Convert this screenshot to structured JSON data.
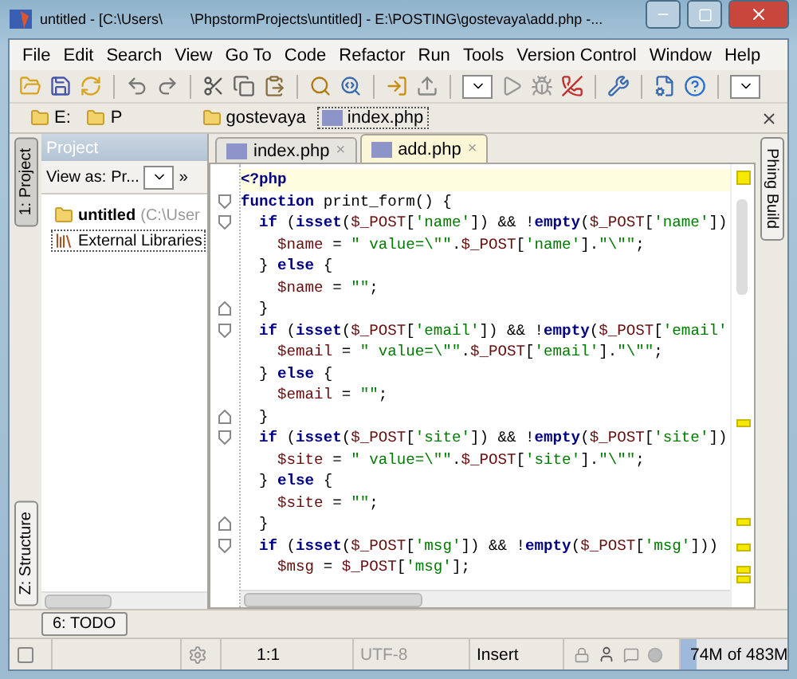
{
  "window": {
    "title": "untitled - [C:\\Users\\       \\PhpstormProjects\\untitled] - E:\\POSTING\\gostevaya\\add.php -..."
  },
  "menu": [
    "File",
    "Edit",
    "Search",
    "View",
    "Go To",
    "Code",
    "Refactor",
    "Run",
    "Tools",
    "Version Control",
    "Window",
    "Help"
  ],
  "breadcrumbs": [
    {
      "label": "E:",
      "kind": "folder"
    },
    {
      "label": "P",
      "kind": "folder"
    },
    {
      "label": "gostevaya",
      "kind": "folder"
    },
    {
      "label": "index.php",
      "kind": "file"
    }
  ],
  "left_tool_tabs": [
    {
      "label": "1: Project",
      "selected": true
    },
    {
      "label": "Z: Structure",
      "selected": false
    }
  ],
  "right_tool_tabs": [
    {
      "label": "Phing Build",
      "selected": false
    }
  ],
  "project_panel": {
    "title": "Project",
    "view_as_label": "View as:",
    "view_as_value": "Pr...",
    "more": "»",
    "tree": [
      {
        "label": "untitled",
        "hint": "(C:\\User",
        "kind": "folder",
        "selected": false
      },
      {
        "label": "External Libraries",
        "kind": "library",
        "selected": true
      }
    ]
  },
  "editor_tabs": [
    {
      "label": "index.php",
      "selected": false,
      "close": "×"
    },
    {
      "label": "add.php",
      "selected": true,
      "close": "×"
    }
  ],
  "code_lines": [
    {
      "kind": "plain",
      "tokens": [
        {
          "text": "**<?php**",
          "color": "#000080"
        }
      ]
    },
    {
      "kind": "fold-start",
      "tokens": [
        {
          "text": "**function**",
          "color": "#000080"
        },
        {
          "text": " print_form() {",
          "color": "#000000"
        }
      ]
    },
    {
      "kind": "fold-start",
      "tokens": [
        {
          "text": "  **if**",
          "color": "#000080"
        },
        {
          "text": " (",
          "color": "#000000"
        },
        {
          "text": "**isset**",
          "color": "#000080"
        },
        {
          "text": "(",
          "color": "#000000"
        },
        {
          "text": "$_POST",
          "color": "#660e0e"
        },
        {
          "text": "[",
          "color": "#000000"
        },
        {
          "text": "'name'",
          "color": "#007a00"
        },
        {
          "text": "]) && !",
          "color": "#000000"
        },
        {
          "text": "**empty**",
          "color": "#000080"
        },
        {
          "text": "(",
          "color": "#000000"
        },
        {
          "text": "$_POST",
          "color": "#660e0e"
        },
        {
          "text": "[",
          "color": "#000000"
        },
        {
          "text": "'name'",
          "color": "#007a00"
        },
        {
          "text": "])",
          "color": "#000000"
        }
      ]
    },
    {
      "kind": "plain",
      "tokens": [
        {
          "text": "    $name",
          "color": "#660e0e"
        },
        {
          "text": " = ",
          "color": "#000000"
        },
        {
          "text": "\" value=\\\"\"",
          "color": "#007a00"
        },
        {
          "text": "."
        },
        {
          "text": "$_POST",
          "color": "#660e0e"
        },
        {
          "text": "[",
          "color": "#000000"
        },
        {
          "text": "'name'",
          "color": "#007a00"
        },
        {
          "text": "].",
          "color": "#000000"
        },
        {
          "text": "\"\\\"\"",
          "color": "#007a00"
        },
        {
          "text": ";",
          "color": "#000000"
        }
      ]
    },
    {
      "kind": "plain",
      "tokens": [
        {
          "text": "  } ",
          "color": "#000000"
        },
        {
          "text": "**else**",
          "color": "#000080"
        },
        {
          "text": " {",
          "color": "#000000"
        }
      ]
    },
    {
      "kind": "plain",
      "tokens": [
        {
          "text": "    $name",
          "color": "#660e0e"
        },
        {
          "text": " = ",
          "color": "#000000"
        },
        {
          "text": "\"\"",
          "color": "#007a00"
        },
        {
          "text": ";",
          "color": "#000000"
        }
      ]
    },
    {
      "kind": "fold-end",
      "tokens": [
        {
          "text": "  }",
          "color": "#000000"
        }
      ]
    },
    {
      "kind": "fold-start",
      "tokens": [
        {
          "text": "  **if**",
          "color": "#000080"
        },
        {
          "text": " (",
          "color": "#000000"
        },
        {
          "text": "**isset**",
          "color": "#000080"
        },
        {
          "text": "(",
          "color": "#000000"
        },
        {
          "text": "$_POST",
          "color": "#660e0e"
        },
        {
          "text": "[",
          "color": "#000000"
        },
        {
          "text": "'email'",
          "color": "#007a00"
        },
        {
          "text": "]) && !",
          "color": "#000000"
        },
        {
          "text": "**empty**",
          "color": "#000080"
        },
        {
          "text": "(",
          "color": "#000000"
        },
        {
          "text": "$_POST",
          "color": "#660e0e"
        },
        {
          "text": "[",
          "color": "#000000"
        },
        {
          "text": "'email'",
          "color": "#007a00"
        }
      ]
    },
    {
      "kind": "plain",
      "tokens": [
        {
          "text": "    $email",
          "color": "#660e0e"
        },
        {
          "text": " = ",
          "color": "#000000"
        },
        {
          "text": "\" value=\\\"\"",
          "color": "#007a00"
        },
        {
          "text": "."
        },
        {
          "text": "$_POST",
          "color": "#660e0e"
        },
        {
          "text": "[",
          "color": "#000000"
        },
        {
          "text": "'email'",
          "color": "#007a00"
        },
        {
          "text": "].",
          "color": "#000000"
        },
        {
          "text": "\"\\\"\"",
          "color": "#007a00"
        },
        {
          "text": ";",
          "color": "#000000"
        }
      ]
    },
    {
      "kind": "plain",
      "tokens": [
        {
          "text": "  } ",
          "color": "#000000"
        },
        {
          "text": "**else**",
          "color": "#000080"
        },
        {
          "text": " {",
          "color": "#000000"
        }
      ]
    },
    {
      "kind": "plain",
      "tokens": [
        {
          "text": "    $email",
          "color": "#660e0e"
        },
        {
          "text": " = ",
          "color": "#000000"
        },
        {
          "text": "\"\"",
          "color": "#007a00"
        },
        {
          "text": ";",
          "color": "#000000"
        }
      ]
    },
    {
      "kind": "fold-end",
      "tokens": [
        {
          "text": "  }",
          "color": "#000000"
        }
      ]
    },
    {
      "kind": "fold-start",
      "tokens": [
        {
          "text": "  **if**",
          "color": "#000080"
        },
        {
          "text": " (",
          "color": "#000000"
        },
        {
          "text": "**isset**",
          "color": "#000080"
        },
        {
          "text": "(",
          "color": "#000000"
        },
        {
          "text": "$_POST",
          "color": "#660e0e"
        },
        {
          "text": "[",
          "color": "#000000"
        },
        {
          "text": "'site'",
          "color": "#007a00"
        },
        {
          "text": "]) && !",
          "color": "#000000"
        },
        {
          "text": "**empty**",
          "color": "#000080"
        },
        {
          "text": "(",
          "color": "#000000"
        },
        {
          "text": "$_POST",
          "color": "#660e0e"
        },
        {
          "text": "[",
          "color": "#000000"
        },
        {
          "text": "'site'",
          "color": "#007a00"
        },
        {
          "text": "])",
          "color": "#000000"
        }
      ]
    },
    {
      "kind": "plain",
      "tokens": [
        {
          "text": "    $site",
          "color": "#660e0e"
        },
        {
          "text": " = ",
          "color": "#000000"
        },
        {
          "text": "\" value=\\\"\"",
          "color": "#007a00"
        },
        {
          "text": "."
        },
        {
          "text": "$_POST",
          "color": "#660e0e"
        },
        {
          "text": "[",
          "color": "#000000"
        },
        {
          "text": "'site'",
          "color": "#007a00"
        },
        {
          "text": "].",
          "color": "#000000"
        },
        {
          "text": "\"\\\"\"",
          "color": "#007a00"
        },
        {
          "text": ";",
          "color": "#000000"
        }
      ]
    },
    {
      "kind": "plain",
      "tokens": [
        {
          "text": "  } ",
          "color": "#000000"
        },
        {
          "text": "**else**",
          "color": "#000080"
        },
        {
          "text": " {",
          "color": "#000000"
        }
      ]
    },
    {
      "kind": "plain",
      "tokens": [
        {
          "text": "    $site",
          "color": "#660e0e"
        },
        {
          "text": " = ",
          "color": "#000000"
        },
        {
          "text": "\"\"",
          "color": "#007a00"
        },
        {
          "text": ";",
          "color": "#000000"
        }
      ]
    },
    {
      "kind": "fold-end",
      "tokens": [
        {
          "text": "  }",
          "color": "#000000"
        }
      ]
    },
    {
      "kind": "fold-start",
      "tokens": [
        {
          "text": "  **if**",
          "color": "#000080"
        },
        {
          "text": " (",
          "color": "#000000"
        },
        {
          "text": "**isset**",
          "color": "#000080"
        },
        {
          "text": "(",
          "color": "#000000"
        },
        {
          "text": "$_POST",
          "color": "#660e0e"
        },
        {
          "text": "[",
          "color": "#000000"
        },
        {
          "text": "'msg'",
          "color": "#007a00"
        },
        {
          "text": "]) && !",
          "color": "#000000"
        },
        {
          "text": "**empty**",
          "color": "#000080"
        },
        {
          "text": "(",
          "color": "#000000"
        },
        {
          "text": "$_POST",
          "color": "#660e0e"
        },
        {
          "text": "[",
          "color": "#000000"
        },
        {
          "text": "'msg'",
          "color": "#007a00"
        },
        {
          "text": "]))",
          "color": "#000000"
        }
      ]
    },
    {
      "kind": "plain",
      "tokens": [
        {
          "text": "    $msg",
          "color": "#660e0e"
        },
        {
          "text": " = ",
          "color": "#000000"
        },
        {
          "text": "$_POST",
          "color": "#660e0e"
        },
        {
          "text": "[",
          "color": "#000000"
        },
        {
          "text": "'msg'",
          "color": "#007a00"
        },
        {
          "text": "];",
          "color": "#000000"
        }
      ]
    }
  ],
  "bottom_tool_tabs": [
    {
      "label": "6: TODO",
      "selected": false
    }
  ],
  "status_bar": {
    "position": "1:1",
    "encoding": "UTF-8",
    "mode": "Insert",
    "memory": {
      "reading": "74M of 483M",
      "level": 0.15
    }
  }
}
